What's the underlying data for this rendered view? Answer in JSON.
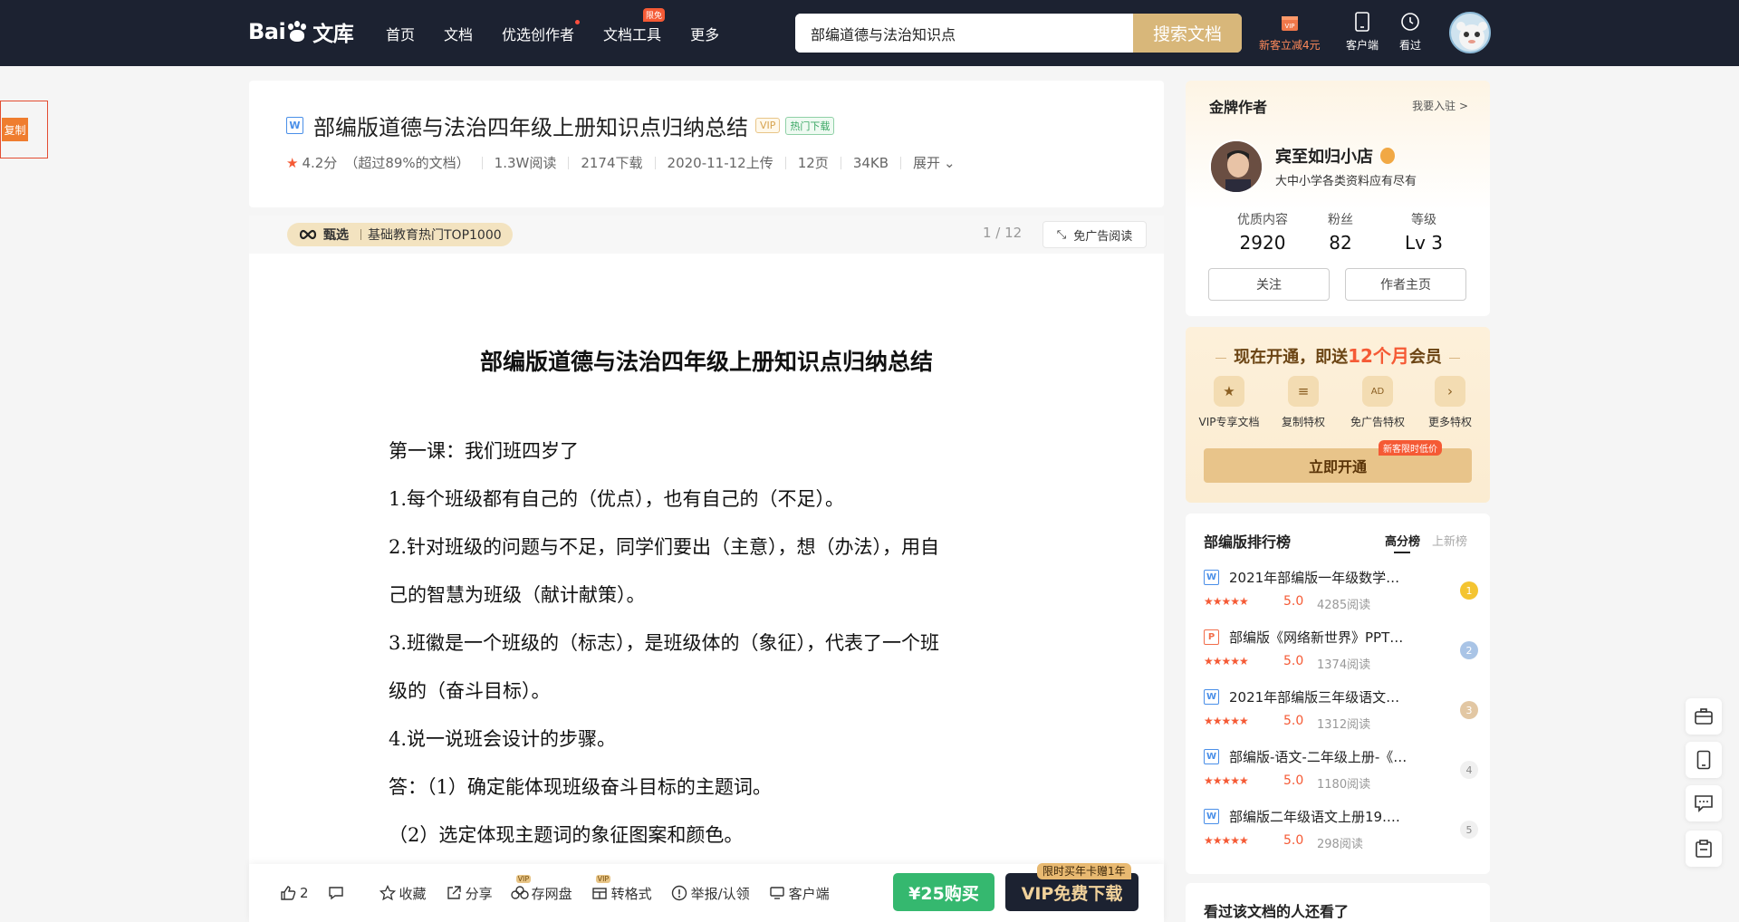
{
  "logo": {
    "text_a": "Bai",
    "text_b": "文库"
  },
  "nav": {
    "items": [
      {
        "label": "首页"
      },
      {
        "label": "文档"
      },
      {
        "label": "优选创作者"
      },
      {
        "label": "文档工具",
        "badge": "限免"
      },
      {
        "label": "更多"
      }
    ]
  },
  "search": {
    "value": "部编道德与法治知识点",
    "button": "搜索文档"
  },
  "top_tools": {
    "newcomer": "新客立减4元",
    "client": "客户端",
    "history": "看过"
  },
  "copy_badge": "复制",
  "doc": {
    "title": "部编版道德与法治四年级上册知识点归纳总结",
    "tag_vip": "VIP",
    "tag_hot": "热门下载",
    "rating": "4.2分",
    "rating_note": "（超过89%的文档）",
    "reads": "1.3W阅读",
    "downloads": "2174下载",
    "upload_date": "2020-11-12上传",
    "pages": "12页",
    "size": "34KB",
    "expand": "展开"
  },
  "select_bar": {
    "brand": "甄选",
    "tag": "基础教育热门TOP1000",
    "page_indicator": "1 / 12",
    "noad": "免广告阅读"
  },
  "content": {
    "heading": "部编版道德与法治四年级上册知识点归纳总结",
    "lines": [
      "第一课：我们班四岁了",
      "1.每个班级都有自己的（优点），也有自己的（不足）。",
      "2.针对班级的问题与不足，同学们要出（主意），想（办法），用自",
      "己的智慧为班级（献计献策）。",
      "3.班徽是一个班级的（标志），是班级体的（象征），代表了一个班",
      "级的（奋斗目标）。",
      "4.说一说班会设计的步骤。",
      "答：（1）确定能体现班级奋斗目标的主题词。",
      "（2）选定体现主题词的象征图案和颜色。"
    ]
  },
  "actions": {
    "likes": "2",
    "collect": "收藏",
    "share": "分享",
    "save_disk": "存网盘",
    "convert": "转格式",
    "vip_tag": "VIP",
    "report": "举报/认领",
    "client": "客户端",
    "buy": "¥25购买",
    "vip_download": "VIP免费下载",
    "vip_download_tag": "限时买年卡赠1年"
  },
  "author": {
    "section_title": "金牌作者",
    "join": "我要入驻 >",
    "name": "宾至如归小店",
    "desc": "大中小学各类资料应有尽有",
    "stats": [
      {
        "label": "优质内容",
        "value": "2920"
      },
      {
        "label": "粉丝",
        "value": "82"
      },
      {
        "label": "等级",
        "value": "Lv 3"
      }
    ],
    "follow": "关注",
    "homepage": "作者主页"
  },
  "vip_promo": {
    "head_a": "现在开通，即送",
    "head_em": "12个月",
    "head_b": "会员",
    "perks": [
      "VIP专享文档",
      "复制特权",
      "免广告特权",
      "更多特权"
    ],
    "open": "立即开通",
    "open_tag": "新客限时低价"
  },
  "ranking": {
    "title": "部编版排行榜",
    "tab_active": "高分榜",
    "tab_other": "上新榜",
    "items": [
      {
        "type": "W",
        "title": "2021年部编版一年级数学…",
        "score": "5.0",
        "reads": "4285阅读",
        "rank": "1"
      },
      {
        "type": "P",
        "title": "部编版《网络新世界》PPT…",
        "score": "5.0",
        "reads": "1374阅读",
        "rank": "2"
      },
      {
        "type": "W",
        "title": "2021年部编版三年级语文…",
        "score": "5.0",
        "reads": "1312阅读",
        "rank": "3"
      },
      {
        "type": "W",
        "title": "部编版-语文-二年级上册-《…",
        "score": "5.0",
        "reads": "1180阅读",
        "rank": "4"
      },
      {
        "type": "W",
        "title": "部编版二年级语文上册19.…",
        "score": "5.0",
        "reads": "298阅读",
        "rank": "5"
      }
    ],
    "stars": "★★★★★"
  },
  "also_viewed": {
    "title": "看过该文档的人还看了"
  },
  "colors": {
    "nav_bg": "#1c2231",
    "accent_gold": "#d8b77a",
    "accent_red": "#f55a35",
    "buy_green": "#35b86f"
  }
}
